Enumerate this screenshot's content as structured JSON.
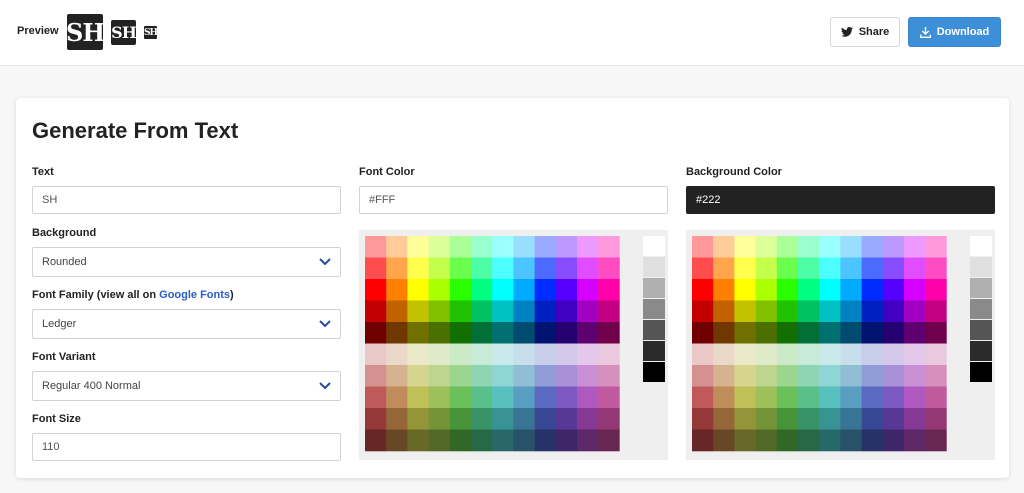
{
  "header": {
    "preview_label": "Preview",
    "favicon_text": "SH",
    "share_label": "Share",
    "download_label": "Download",
    "share_icon": "twitter-icon",
    "download_icon": "download-icon",
    "accent_color": "#3d8fd8"
  },
  "form": {
    "title": "Generate From Text",
    "text": {
      "label": "Text",
      "value": "SH"
    },
    "background": {
      "label": "Background",
      "value": "Rounded"
    },
    "font_family": {
      "label_prefix": "Font Family (view all on ",
      "link": "Google Fonts",
      "label_suffix": ")",
      "value": "Ledger"
    },
    "font_variant": {
      "label": "Font Variant",
      "value": "Regular 400 Normal"
    },
    "font_size": {
      "label": "Font Size",
      "value": "110"
    },
    "font_color": {
      "label": "Font Color",
      "value": "#FFF"
    },
    "background_color": {
      "label": "Background Color",
      "value": "#222"
    }
  },
  "palette": {
    "hues": [
      0,
      30,
      60,
      80,
      110,
      150,
      180,
      200,
      230,
      260,
      290,
      320
    ],
    "grays": [
      "#ffffff",
      "#e0e0e0",
      "#b0b0b0",
      "#8a8a8a",
      "#555555",
      "#2b2b2b",
      "#000000"
    ]
  }
}
